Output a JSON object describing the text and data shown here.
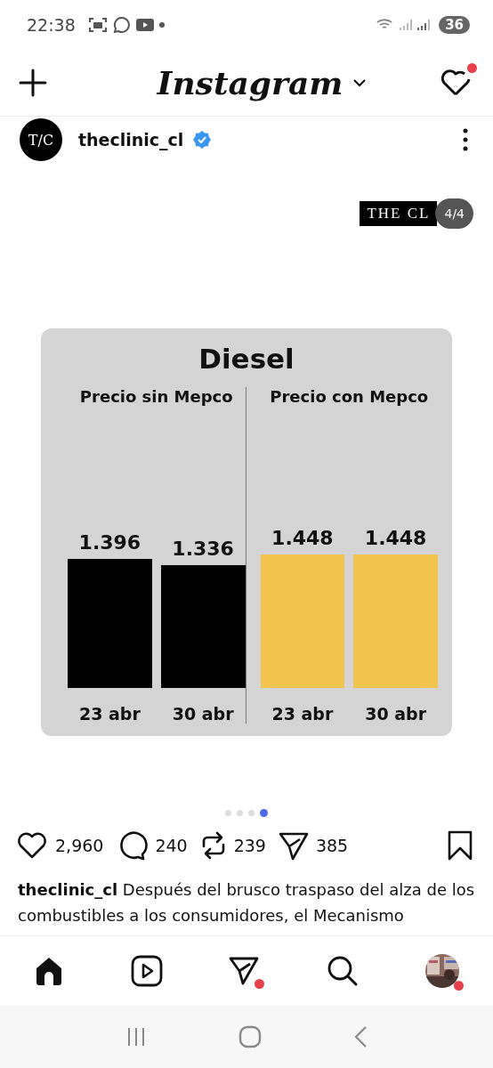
{
  "status_bar": {
    "time": "22:38",
    "battery": "36"
  },
  "header": {
    "title": "Instagram",
    "notifications_unread": true
  },
  "post": {
    "avatar_text": "T/C",
    "username": "theclinic_cl",
    "verified": true,
    "image": {
      "logo": "THE CL",
      "counter": "4/4",
      "card_title": "Diesel",
      "panels": [
        {
          "chart_data": {
            "type": "bar",
            "title": "Precio sin Mepco",
            "categories": [
              "23 abr",
              "30 abr"
            ],
            "series": [
              {
                "color": "#000000",
                "values": [
                  1.396,
                  1.336
                ]
              }
            ],
            "data_labels": true
          }
        },
        {
          "chart_data": {
            "type": "bar",
            "title": "Precio con Mepco",
            "categories": [
              "23 abr",
              "30 abr"
            ],
            "series": [
              {
                "color": "#f2c44f",
                "values": [
                  1.448,
                  1.448
                ]
              }
            ],
            "data_labels": true
          }
        }
      ]
    },
    "carousel": [
      {
        "selected": false
      },
      {
        "selected": false
      },
      {
        "selected": false
      },
      {
        "selected": true
      }
    ],
    "actions": {
      "likes": "2,960",
      "comments": "240",
      "reposts": "239",
      "shares": "385"
    },
    "caption": {
      "username": "theclinic_cl",
      "text": "Después del brusco traspaso del alza de los combustibles a los consumidores, el Mecanismo"
    }
  },
  "nav": [
    {
      "kind": "home",
      "selected": true,
      "badge": false
    },
    {
      "kind": "reels",
      "selected": false,
      "badge": false
    },
    {
      "kind": "messages",
      "selected": false,
      "badge": true
    },
    {
      "kind": "search",
      "selected": false,
      "badge": false
    },
    {
      "kind": "profile",
      "selected": false,
      "badge": true
    }
  ]
}
